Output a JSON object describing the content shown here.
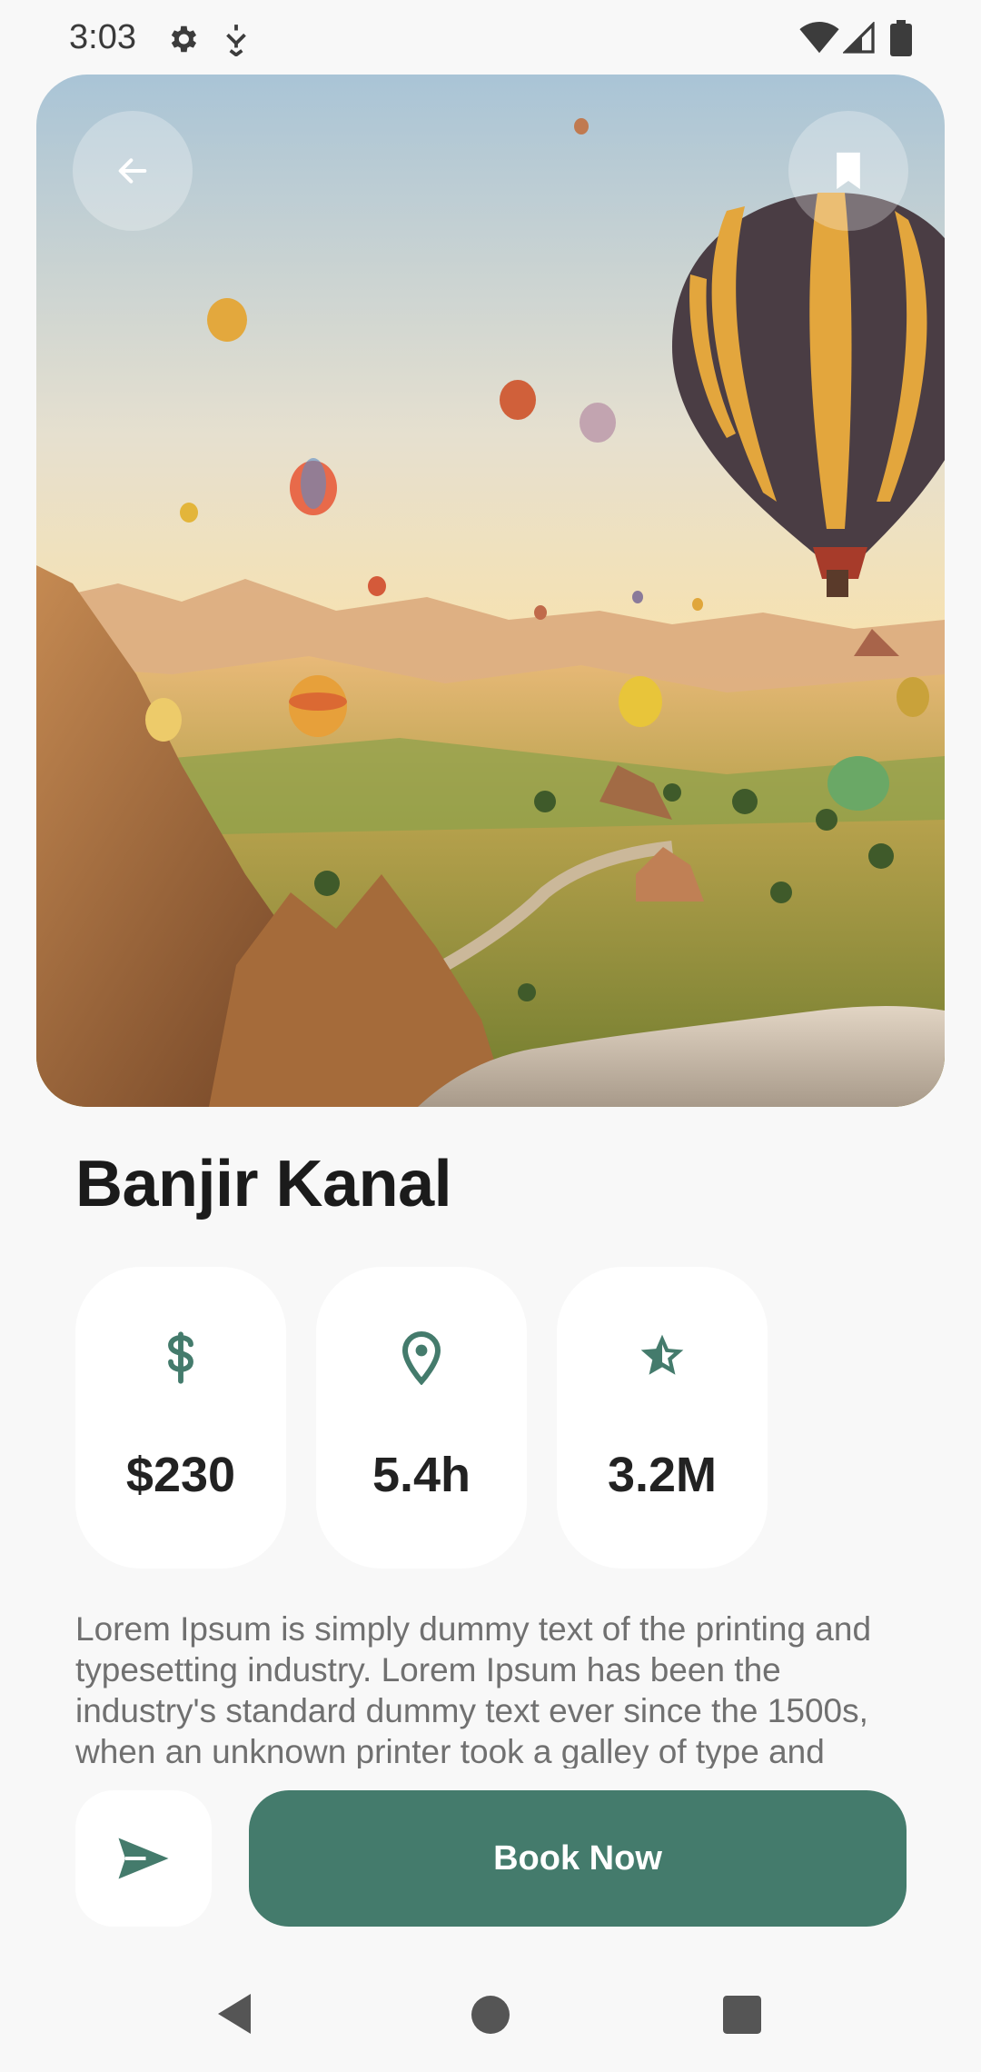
{
  "status_bar": {
    "time": "3:03",
    "icons": [
      "gear-icon",
      "usb-debug-icon",
      "wifi-icon",
      "signal-icon",
      "battery-icon"
    ]
  },
  "hero": {
    "image": "hot-air-balloons-over-valley",
    "back_icon": "arrow-left-icon",
    "bookmark_icon": "bookmark-icon"
  },
  "place": {
    "title": "Banjir Kanal"
  },
  "stats": [
    {
      "icon": "dollar-icon",
      "value": "$230"
    },
    {
      "icon": "location-pin-icon",
      "value": "5.4h"
    },
    {
      "icon": "star-icon",
      "value": "3.2M"
    }
  ],
  "description": "Lorem Ipsum is simply dummy text of the printing and typesetting industry. Lorem Ipsum has been the industry's standard dummy text ever since the 1500s, when an unknown printer took a galley of type and scrambled it to make a type specimen book.",
  "actions": {
    "share_icon": "send-icon",
    "book_label": "Book Now"
  },
  "nav": [
    "nav-back-icon",
    "nav-home-icon",
    "nav-recents-icon"
  ],
  "colors": {
    "accent": "#447b6c",
    "background": "#f8f8f8",
    "card": "#ffffff",
    "title": "#1b1b1b",
    "body_text": "#707070"
  }
}
